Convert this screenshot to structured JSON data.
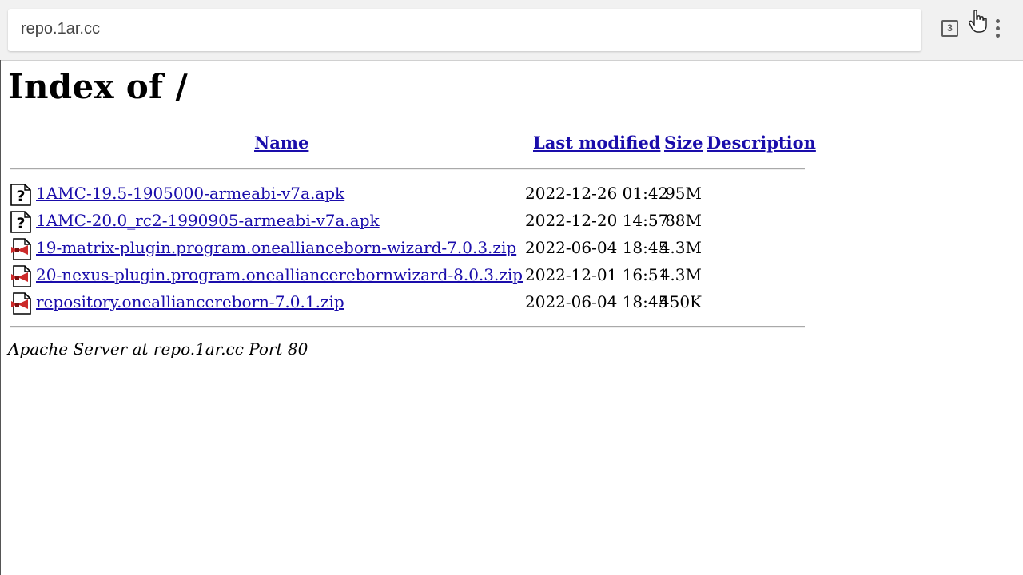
{
  "browser": {
    "url": "repo.1ar.cc",
    "tab_count": "3"
  },
  "page": {
    "title": "Index of /",
    "columns": {
      "name": "Name",
      "last_modified": "Last modified",
      "size": "Size",
      "description": "Description"
    },
    "files": [
      {
        "name": "1AMC-19.5-1905000-armeabi-v7a.apk",
        "modified": "2022-12-26 01:42",
        "size": "95M",
        "icon": "unknown-file-icon"
      },
      {
        "name": "1AMC-20.0_rc2-1990905-armeabi-v7a.apk",
        "modified": "2022-12-20 14:57",
        "size": "88M",
        "icon": "unknown-file-icon"
      },
      {
        "name": "19-matrix-plugin.program.oneallianceborn-wizard-7.0.3.zip",
        "modified": "2022-06-04 18:45",
        "size": "4.3M",
        "icon": "compressed-file-icon"
      },
      {
        "name": "20-nexus-plugin.program.onealliancerebornwizard-8.0.3.zip",
        "modified": "2022-12-01 16:51",
        "size": "4.3M",
        "icon": "compressed-file-icon"
      },
      {
        "name": "repository.onealliancereborn-7.0.1.zip",
        "modified": "2022-06-04 18:45",
        "size": "450K",
        "icon": "compressed-file-icon"
      }
    ],
    "footer": "Apache Server at repo.1ar.cc Port 80"
  },
  "colors": {
    "link": "#1a0dab",
    "rule": "#a9a9a9",
    "zip_icon": "#cc2a2a"
  }
}
